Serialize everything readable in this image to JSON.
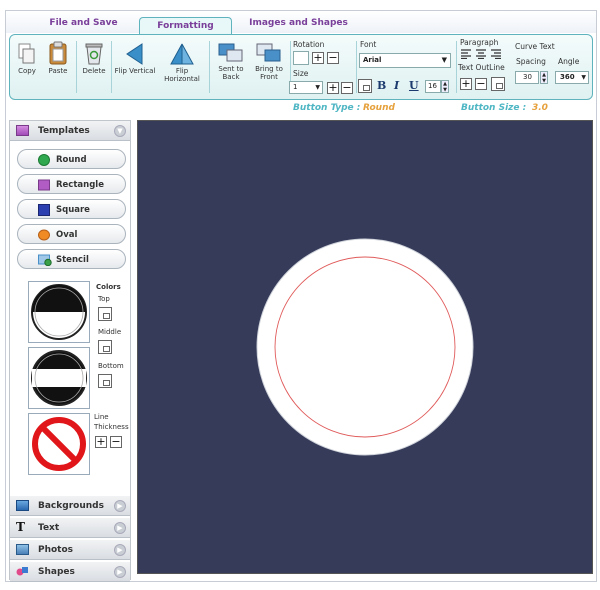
{
  "tabs": [
    {
      "label": "File and Save",
      "active": false
    },
    {
      "label": "Formatting",
      "active": true
    },
    {
      "label": "Images and Shapes",
      "active": false
    }
  ],
  "toolbar": {
    "copy": "Copy",
    "paste": "Paste",
    "delete": "Delete",
    "flip_vertical": "Flip Vertical",
    "flip_horizontal": "Flip Horizontal",
    "send_to_back_1": "Sent to",
    "send_to_back_2": "Back",
    "bring_to_front_1": "Bring to",
    "bring_to_front_2": "Front",
    "rotation_label": "Rotation",
    "size_label": "Size",
    "size_value": "1",
    "font_label": "Font",
    "font_value": "Arial",
    "bold": "B",
    "italic": "I",
    "underline": "U",
    "font_size": "16",
    "paragraph_label": "Paragraph",
    "text_outline_label": "Text OutLine",
    "curve_text_label": "Curve Text",
    "spacing_label": "Spacing",
    "spacing_value": "30",
    "angle_label": "Angle",
    "angle_value": "360",
    "plus": "+",
    "minus": "−"
  },
  "status": {
    "button_type_label": "Button Type :",
    "button_type_value": "Round",
    "button_size_label": "Button Size :",
    "button_size_value": "3.0"
  },
  "left_panel": {
    "templates_label": "Templates",
    "shapes": [
      {
        "label": "Round",
        "icon": "green-circle-icon",
        "color": "#2fa84f"
      },
      {
        "label": "Rectangle",
        "icon": "purple-rectangle-icon",
        "color": "#b05cc4"
      },
      {
        "label": "Square",
        "icon": "blue-square-icon",
        "color": "#2c3fb0"
      },
      {
        "label": "Oval",
        "icon": "orange-oval-icon",
        "color": "#f08a24"
      },
      {
        "label": "Stencil",
        "icon": "stencil-icon",
        "color": "#4a90c8"
      }
    ],
    "colors_label": "Colors",
    "top_label": "Top",
    "middle_label": "Middle",
    "bottom_label": "Bottom",
    "line_label": "Line",
    "thickness_label": "Thickness",
    "backgrounds_label": "Backgrounds",
    "text_label": "Text",
    "photos_label": "Photos",
    "shapes_label": "Shapes"
  },
  "canvas": {
    "background": "#363b5a",
    "button_fill": "#ffffff",
    "guide_color": "#e05a5a"
  }
}
